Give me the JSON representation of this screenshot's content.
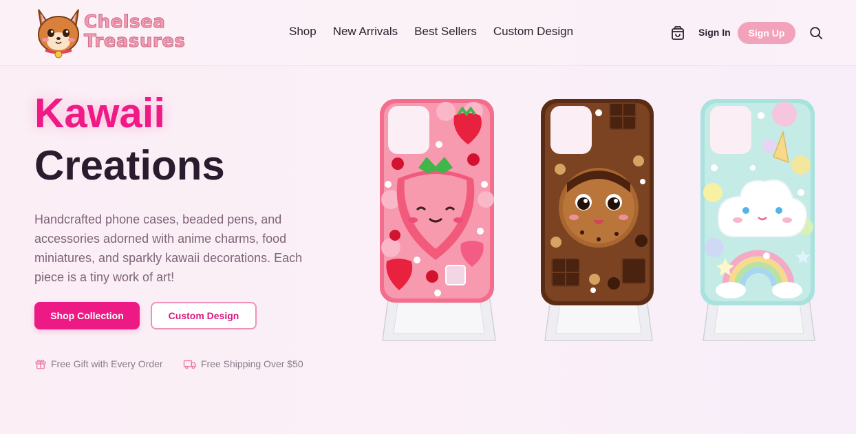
{
  "brand": {
    "line1": "Chelsea",
    "line2": "Treasures",
    "mascot_icon": "corgi-mascot-icon"
  },
  "nav": {
    "items": [
      {
        "label": "Shop"
      },
      {
        "label": "New Arrivals"
      },
      {
        "label": "Best Sellers"
      },
      {
        "label": "Custom Design"
      }
    ]
  },
  "header_actions": {
    "cart_icon": "shopping-bag-icon",
    "sign_in": "Sign In",
    "sign_up": "Sign Up",
    "search_icon": "search-icon"
  },
  "hero": {
    "title_accent": "Kawaii",
    "title_main": "Creations",
    "description": "Handcrafted phone cases, beaded pens, and accessories adorned with anime charms, food miniatures, and sparkly kawaii decorations. Each piece is a tiny work of art!",
    "primary_cta": "Shop Collection",
    "secondary_cta": "Custom Design",
    "perks": [
      {
        "icon": "gift-icon",
        "label": "Free Gift with Every Order"
      },
      {
        "icon": "truck-icon",
        "label": "Free Shipping Over $50"
      }
    ]
  },
  "products": [
    {
      "name": "strawberry-case",
      "colors": {
        "primary": "#f05a7e",
        "accent": "#e8213f"
      }
    },
    {
      "name": "chocolate-cookie-case",
      "colors": {
        "primary": "#6b3a1f",
        "accent": "#a0642e"
      }
    },
    {
      "name": "unicorn-cloud-case",
      "colors": {
        "primary": "#b8e8e4",
        "accent": "#f4c6e0"
      }
    }
  ],
  "colors": {
    "accent": "#ed1a86",
    "signup": "#f3a2bb",
    "heading": "#2b1b2e",
    "body_text": "#7e6478"
  }
}
